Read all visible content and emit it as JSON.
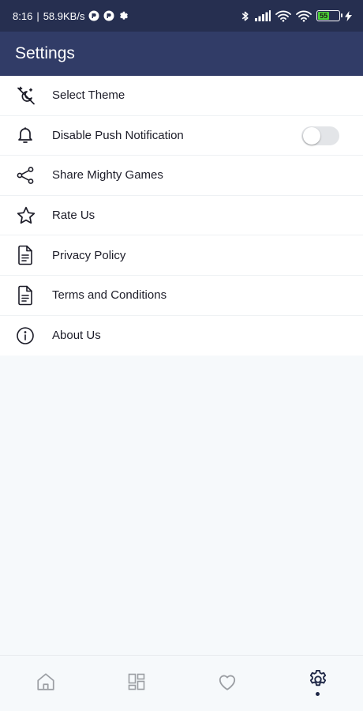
{
  "status_bar": {
    "time": "8:16",
    "separator": "|",
    "speed": "58.9KB/s",
    "battery_level": "55",
    "battery_fraction": 0.55
  },
  "app_bar": {
    "title": "Settings"
  },
  "settings": {
    "items": [
      {
        "label": "Select Theme",
        "icon": "theme-icon"
      },
      {
        "label": "Disable Push Notification",
        "icon": "bell-icon",
        "toggle_on": false
      },
      {
        "label": "Share Mighty Games",
        "icon": "share-icon"
      },
      {
        "label": "Rate Us",
        "icon": "star-icon"
      },
      {
        "label": "Privacy Policy",
        "icon": "document-icon"
      },
      {
        "label": "Terms and Conditions",
        "icon": "document-icon"
      },
      {
        "label": "About Us",
        "icon": "info-icon"
      }
    ]
  },
  "bottom_nav": {
    "items": [
      {
        "icon": "home-icon"
      },
      {
        "icon": "dashboard-icon"
      },
      {
        "icon": "heart-icon"
      },
      {
        "icon": "gear-icon",
        "active": true
      }
    ]
  },
  "colors": {
    "status_bar": "#262f50",
    "app_bar": "#313c67",
    "background": "#f6f9fb",
    "nav_inactive": "#9b9ea3",
    "nav_active": "#1f2847"
  }
}
